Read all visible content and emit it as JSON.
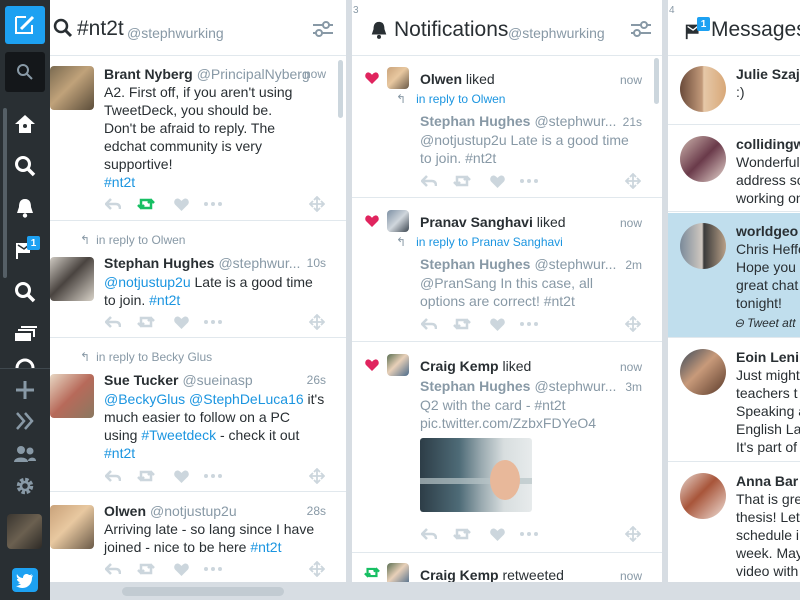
{
  "sidebar": {
    "messages_badge": "1"
  },
  "col1": {
    "number": "",
    "title": "#nt2t",
    "user": "@stephwurking",
    "tweets": [
      {
        "name": "Brant Nyberg",
        "handle": "@PrincipalNyberg",
        "time": "now",
        "lines": [
          "A2. First off, if you aren't using",
          "TweetDeck, you should be.",
          "Don't be afraid to reply. The",
          "edchat community is very",
          "supportive!"
        ],
        "hashtag": "#nt2t"
      },
      {
        "reply_prefix": "in reply to",
        "reply_to": "Olwen",
        "name": "Stephan Hughes",
        "handle": "@stephwur...",
        "time": "10s",
        "mention": "@notjustup2u",
        "line1_rest": " Late is a good time",
        "line2_text": "to join. ",
        "hashtag": "#nt2t"
      },
      {
        "reply_prefix": "in reply to",
        "reply_to": "Becky Glus",
        "name": "Sue Tucker",
        "handle": "@sueinasp",
        "time": "26s",
        "mention1": "@BeckyGlus",
        "mention2": "@StephDeLuca16",
        "line1_rest": " it's",
        "line2": "much easier to follow on a PC",
        "line3_pre": "using ",
        "line3_tag": "#Tweetdeck",
        "line3_rest": " - check it out",
        "hashtag": "#nt2t"
      },
      {
        "name": "Olwen",
        "handle": "@notjustup2u",
        "time": "28s",
        "line1": "Arriving late - so lang since I have",
        "line2_pre": "joined - nice to be here ",
        "hashtag": "#nt2t"
      }
    ]
  },
  "col2": {
    "number": "3",
    "title": "Notifications",
    "user": "@stephwurking",
    "items": [
      {
        "actor": "Olwen",
        "verb": "liked",
        "time": "now",
        "reply_prefix": "in reply to",
        "reply_to": "Olwen",
        "q_name": "Stephan Hughes",
        "q_handle": "@stephwur...",
        "q_time": "21s",
        "q_line1": "@notjustup2u Late is a good time",
        "q_line2": "to join. #nt2t"
      },
      {
        "actor": "Pranav Sanghavi",
        "verb": "liked",
        "time": "now",
        "reply_prefix": "in reply to",
        "reply_to": "Pranav Sanghavi",
        "q_name": "Stephan Hughes",
        "q_handle": "@stephwur...",
        "q_time": "2m",
        "q_line1": "@PranSang In this case, all",
        "q_line2": "options are correct! #nt2t"
      },
      {
        "actor": "Craig Kemp",
        "verb": "liked",
        "time": "now",
        "q_name": "Stephan Hughes",
        "q_handle": "@stephwur...",
        "q_time": "3m",
        "q_line1": "Q2 with the card - #nt2t",
        "q_line2": "pic.twitter.com/ZzbxFDYeO4"
      },
      {
        "actor": "Craig Kemp",
        "verb": "retweeted",
        "time": "now"
      }
    ]
  },
  "col3": {
    "number": "4",
    "title": "Messages",
    "badge": "1",
    "items": [
      {
        "name": "Julie Szaj",
        "line1": ":)"
      },
      {
        "name": "collidingw",
        "lines": [
          "Wonderful",
          "address so",
          "working on"
        ]
      },
      {
        "name": "worldgeo",
        "lines": [
          "Chris Heffe",
          "Hope you",
          "great chat",
          "tonight!"
        ],
        "footer": "Tweet att"
      },
      {
        "name": "Eoin Lenih",
        "lines": [
          "Just might",
          "teachers t",
          "Speaking a",
          "English La",
          "It's part of"
        ]
      },
      {
        "name": "Anna Bar",
        "lines": [
          "That is gre",
          "thesis! Let",
          "schedule i",
          "week. May",
          "video with"
        ]
      }
    ]
  },
  "colors": {
    "accent": "#1da1f2",
    "link": "#1b95e0",
    "like": "#e0245e",
    "retweet": "#17bf63",
    "selected": "#c0deed"
  }
}
